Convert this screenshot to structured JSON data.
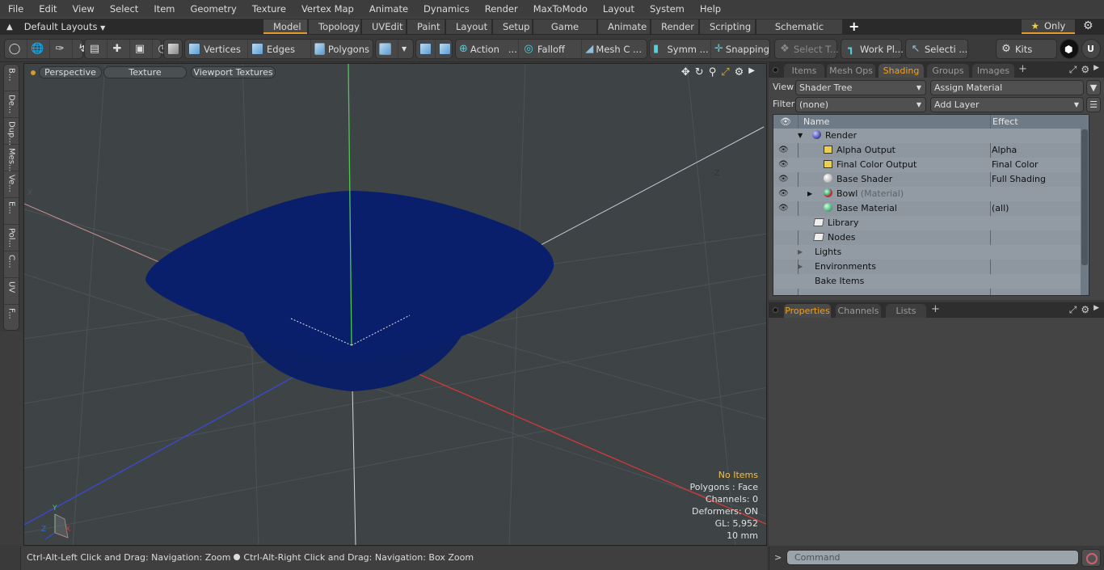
{
  "menubar": {
    "items": [
      "File",
      "Edit",
      "View",
      "Select",
      "Item",
      "Geometry",
      "Texture",
      "Vertex Map",
      "Animate",
      "Dynamics",
      "Render",
      "MaxToModo",
      "Layout",
      "System",
      "Help"
    ]
  },
  "layoutbar": {
    "layouts_label": "Default Layouts",
    "tabs": [
      "Model",
      "Topology",
      "UVEdit",
      "Paint",
      "Layout",
      "Setup",
      "Game Tools",
      "Animate",
      "Render",
      "Scripting",
      "Schematic Fusion"
    ],
    "active_tab": "Model",
    "add_label": "+",
    "only_label": "Only"
  },
  "toolbar": {
    "vertices": "Vertices",
    "edges": "Edges",
    "polygons": "Polygons",
    "action": "Action",
    "action_more": "...",
    "falloff": "Falloff",
    "meshc": "Mesh C ...",
    "symm": "Symm ...",
    "snapping": "Snapping",
    "select_t": "Select T...",
    "workpl": "Work Pl...",
    "selecti": "Selecti ...",
    "kits": "Kits"
  },
  "leftstrip": {
    "tabs": [
      "B...",
      "De...",
      "Dup...",
      "Mes...",
      "Ve...",
      "E...",
      "Pol...",
      "C...",
      "UV",
      "F..."
    ]
  },
  "viewport": {
    "view_mode": "Perspective",
    "shading_mode": "Texture",
    "texture_mode": "Viewport Textures",
    "axis_label_neg_z": "-Z",
    "axis_label_x": "X",
    "info": {
      "selection": "No Items",
      "polygons": "Polygons : Face",
      "channels": "Channels: 0",
      "deformers": "Deformers: ON",
      "gl": "GL: 5,952",
      "scale": "10 mm"
    },
    "gizmo": {
      "y": "Y",
      "z": "Z",
      "x": "X"
    },
    "colors": {
      "background": "#3e4346",
      "mesh": "#0a1f6b",
      "x_axis": "#d23a3a",
      "y_axis": "#4ec94e",
      "z_axis": "#3a4ad2"
    }
  },
  "statusbar": {
    "hint_left": "Ctrl-Alt-Left Click and Drag: Navigation: Zoom",
    "hint_right": "Ctrl-Alt-Right Click and Drag: Navigation: Box Zoom"
  },
  "rightpanel": {
    "top_tabs": [
      "Items",
      "Mesh Ops",
      "Shading",
      "Groups",
      "Images"
    ],
    "active_top_tab": "Shading",
    "view_label": "View",
    "view_value": "Shader Tree",
    "assign_material": "Assign Material",
    "filter_label": "Filter",
    "filter_value": "(none)",
    "add_layer": "Add Layer",
    "columns": {
      "name": "Name",
      "effect": "Effect"
    },
    "rows": [
      {
        "name": "Render",
        "effect": "",
        "icon": "render-sphere"
      },
      {
        "name": "Alpha Output",
        "effect": "Alpha",
        "icon": "output"
      },
      {
        "name": "Final Color Output",
        "effect": "Final Color",
        "icon": "output"
      },
      {
        "name": "Base Shader",
        "effect": "Full Shading",
        "icon": "shader-sphere"
      },
      {
        "name": "Bowl",
        "suffix": "(Material)",
        "effect": "",
        "icon": "material-mask"
      },
      {
        "name": "Base Material",
        "effect": "(all)",
        "icon": "material-sphere"
      },
      {
        "name": "Library",
        "effect": "",
        "icon": "folder"
      },
      {
        "name": "Nodes",
        "effect": "",
        "icon": "folder"
      },
      {
        "name": "Lights",
        "effect": "",
        "icon": ""
      },
      {
        "name": "Environments",
        "effect": "",
        "icon": ""
      },
      {
        "name": "Bake Items",
        "effect": "",
        "icon": ""
      }
    ],
    "bottom_tabs": [
      "Properties",
      "Channels",
      "Lists"
    ],
    "active_bottom_tab": "Properties"
  },
  "commandbar": {
    "prompt": ">",
    "placeholder": "Command"
  }
}
